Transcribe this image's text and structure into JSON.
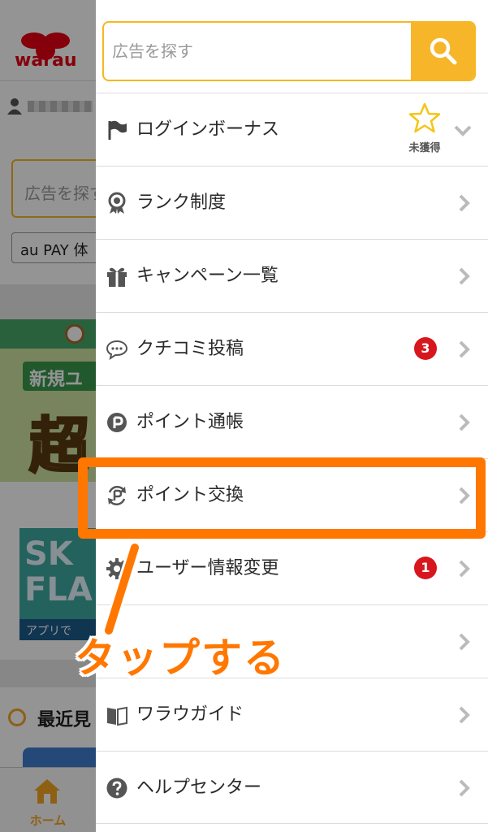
{
  "background": {
    "logo_text": "warau",
    "search_placeholder": "広告を探す",
    "chip_label": "au PAY 体",
    "banner1_heading": "新規ユ",
    "banner1_big": "超",
    "banner2_text": "SK FLA",
    "banner2_foot": "アプリで",
    "recent_title": "最近見",
    "home_label": "ホーム"
  },
  "drawer": {
    "search": {
      "placeholder": "広告を探す",
      "icon": "search-icon"
    },
    "menu": [
      {
        "label": "ログインボーナス",
        "icon": "flag-icon",
        "status_label": "未獲得",
        "trailing": "chevron-down-icon"
      },
      {
        "label": "ランク制度",
        "icon": "medal-icon",
        "trailing": "chevron-right-icon"
      },
      {
        "label": "キャンペーン一覧",
        "icon": "gift-icon",
        "trailing": "chevron-right-icon"
      },
      {
        "label": "クチコミ投稿",
        "icon": "speech-bubble-icon",
        "badge": "3",
        "trailing": "chevron-right-icon"
      },
      {
        "label": "ポイント通帳",
        "icon": "point-icon",
        "trailing": "chevron-right-icon"
      },
      {
        "label": "ポイント交換",
        "icon": "point-exchange-icon",
        "trailing": "chevron-right-icon"
      },
      {
        "label": "ユーザー情報変更",
        "icon": "gear-icon",
        "badge": "1",
        "trailing": "chevron-right-icon"
      },
      {
        "label": "",
        "icon": "",
        "trailing": "chevron-right-icon"
      },
      {
        "label": "ワラウガイド",
        "icon": "book-icon",
        "trailing": "chevron-right-icon"
      },
      {
        "label": "ヘルプセンター",
        "icon": "help-icon",
        "trailing": "chevron-right-icon"
      }
    ]
  },
  "annotation": {
    "callout_text": "タップする",
    "highlight_color": "#ff7700"
  },
  "colors": {
    "accent": "#f7b52a",
    "badge": "#d7171d",
    "brand": "#e60012"
  }
}
